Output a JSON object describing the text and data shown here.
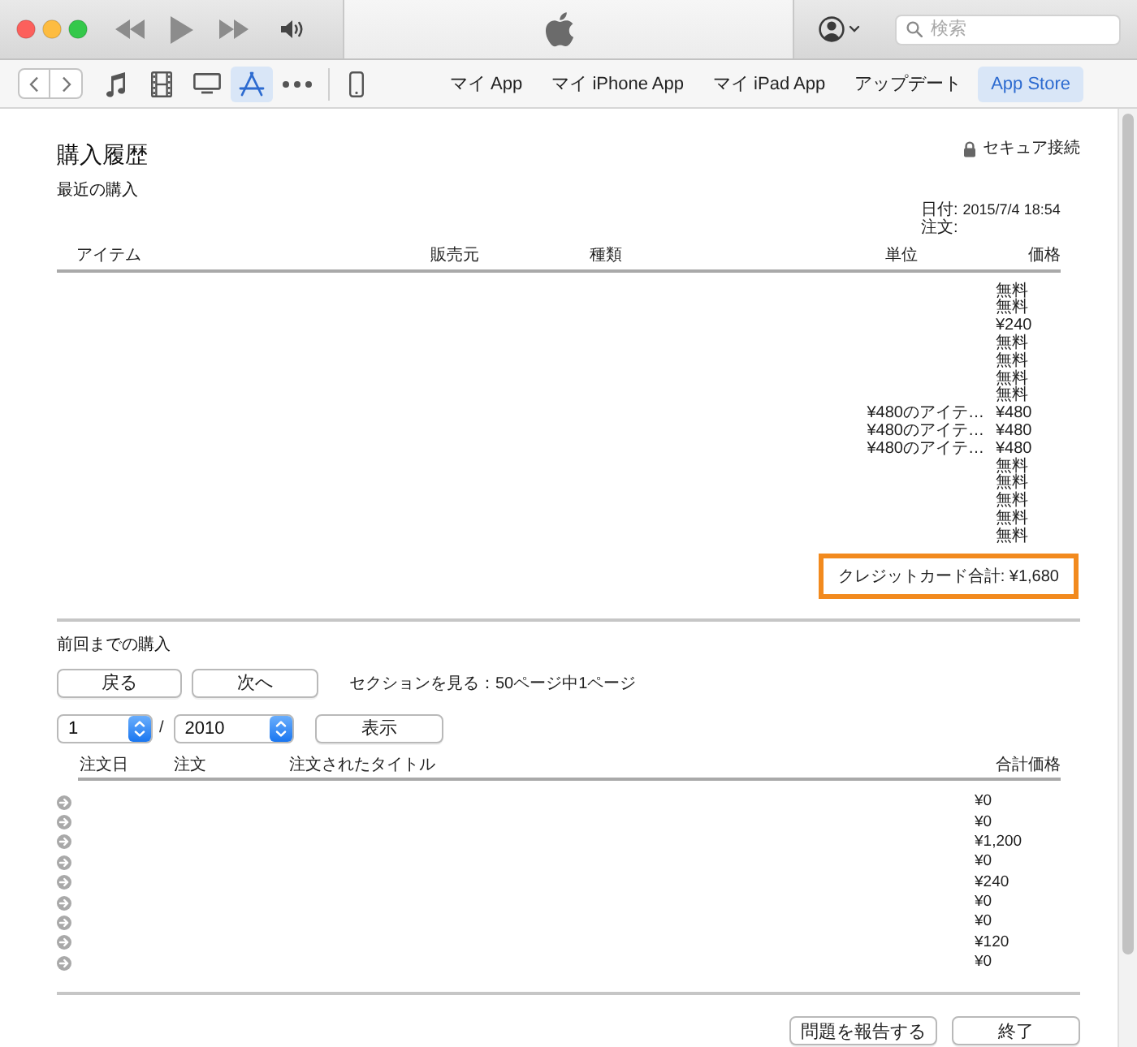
{
  "search": {
    "placeholder": "検索"
  },
  "media_tabs": [
    {
      "kind": "music",
      "selected": false
    },
    {
      "kind": "movies",
      "selected": false
    },
    {
      "kind": "tv",
      "selected": false
    },
    {
      "kind": "apps",
      "selected": true
    },
    {
      "kind": "more",
      "selected": false
    }
  ],
  "nav_tabs": [
    {
      "label": "マイ App",
      "selected": false
    },
    {
      "label": "マイ iPhone App",
      "selected": false
    },
    {
      "label": "マイ iPad App",
      "selected": false
    },
    {
      "label": "アップデート",
      "selected": false
    },
    {
      "label": "App Store",
      "selected": true
    }
  ],
  "page": {
    "title": "購入履歴",
    "secure_label": "セキュア接続"
  },
  "recent": {
    "heading": "最近の購入",
    "date_label": "日付:",
    "date": "2015/7/4 18:54",
    "order_label": "注文:",
    "columns": [
      "アイテム",
      "販売元",
      "種類",
      "単位",
      "価格"
    ],
    "rows": [
      {
        "price": "無料"
      },
      {
        "price": "無料"
      },
      {
        "price": "¥240"
      },
      {
        "price": "無料"
      },
      {
        "price": "無料"
      },
      {
        "price": "無料"
      },
      {
        "price": "無料"
      },
      {
        "unit": "¥480のアイテ…",
        "price": "¥480"
      },
      {
        "unit": "¥480のアイテ…",
        "price": "¥480"
      },
      {
        "unit": "¥480のアイテ…",
        "price": "¥480"
      },
      {
        "price": "無料"
      },
      {
        "price": "無料"
      },
      {
        "price": "無料"
      },
      {
        "price": "無料"
      },
      {
        "price": "無料"
      }
    ],
    "total": {
      "text": "クレジットカード合計: ¥1,680",
      "highlighted": true
    }
  },
  "previous": {
    "heading": "前回までの購入",
    "buttons": [
      "戻る",
      "次へ"
    ],
    "page_info": "セクションを見る：50ページ中1ページ",
    "month": "1",
    "separator": "/",
    "year": "2010",
    "show_button": "表示",
    "columns": [
      "注文日",
      "注文",
      "注文されたタイトル",
      "合計価格"
    ],
    "rows": [
      {
        "total": "¥0"
      },
      {
        "total": "¥0"
      },
      {
        "total": "¥1,200"
      },
      {
        "total": "¥0"
      },
      {
        "total": "¥240"
      },
      {
        "total": "¥0"
      },
      {
        "total": "¥0"
      },
      {
        "total": "¥120"
      },
      {
        "total": "¥0"
      }
    ]
  },
  "footer_buttons": [
    "問題を報告する",
    "終了"
  ]
}
